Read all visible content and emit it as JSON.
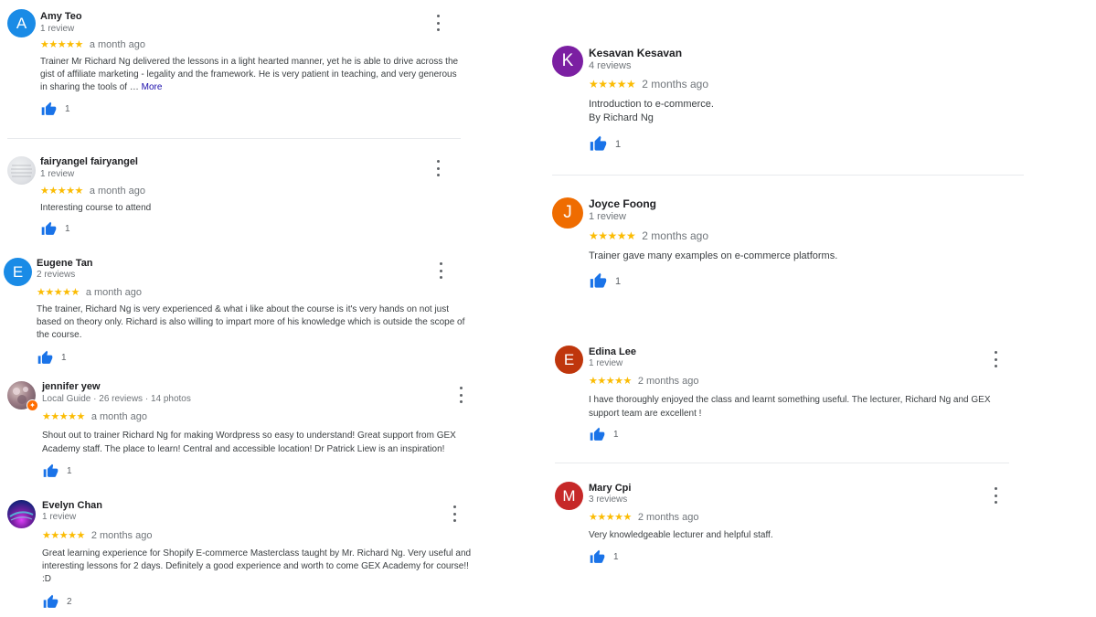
{
  "colors": {
    "star": "#fbbc04",
    "thumb": "#1a73e8",
    "more_link": "#1a0dab"
  },
  "reviews": [
    {
      "name": "Amy Teo",
      "meta": "1 review",
      "avatar_letter": "A",
      "avatar_color": "#1a8be6",
      "stars": "★★★★★",
      "rating": 5,
      "age": "a month ago",
      "text": "Trainer Mr Richard Ng delivered the lessons in a light hearted manner, yet he is able to drive across the gist of  affiliate marketing - legality and  the framework. He is very patient in teaching, and very generous in sharing the tools of … ",
      "more": "More",
      "likes": "1"
    },
    {
      "name": "fairyangel fairyangel",
      "meta": "1 review",
      "avatar_icon": "profile-photo-icon",
      "stars": "★★★★★",
      "rating": 5,
      "age": "a month ago",
      "text": "Interesting course to attend",
      "likes": "1"
    },
    {
      "name": "Eugene Tan",
      "meta": "2 reviews",
      "avatar_letter": "E",
      "avatar_color": "#1a8be6",
      "stars": "★★★★★",
      "rating": 5,
      "age": "a month ago",
      "text": "The trainer, Richard Ng is very experienced & what i like about the course is it's very hands on not just based on theory only. Richard is also willing to impart more of his knowledge which is outside the scope of the course.",
      "likes": "1"
    },
    {
      "name": "jennifer yew",
      "meta": "Local Guide · 26 reviews · 14 photos",
      "avatar_icon": "profile-photo-icon",
      "stars": "★★★★★",
      "rating": 5,
      "age": "a month ago",
      "text": "Shout out to trainer Richard Ng for making Wordpress so easy to understand! Great support from GEX Academy staff. The place to learn! Central and accessible location! Dr Patrick Liew is an inspiration!",
      "likes": "1"
    },
    {
      "name": "Evelyn Chan",
      "meta": "1 review",
      "avatar_icon": "profile-photo-icon",
      "stars": "★★★★★",
      "rating": 5,
      "age": "2 months ago",
      "text": "Great learning experience for Shopify E-commerce Masterclass taught by Mr. Richard Ng. Very useful and interesting lessons for 2 days. Definitely a good experience and worth to come GEX Academy for course!! :D",
      "likes": "2"
    },
    {
      "name": "Kesavan Kesavan",
      "meta": "4 reviews",
      "avatar_letter": "K",
      "avatar_color": "#7b1fa2",
      "stars": "★★★★★",
      "rating": 5,
      "age": "2 months ago",
      "text_line1": "Introduction to e-commerce.",
      "text_line2": "By Richard Ng",
      "likes": "1"
    },
    {
      "name": "Joyce Foong",
      "meta": "1 review",
      "avatar_letter": "J",
      "avatar_color": "#ef6c00",
      "stars": "★★★★★",
      "rating": 5,
      "age": "2 months ago",
      "text": "Trainer gave many examples on e-commerce platforms.",
      "likes": "1"
    },
    {
      "name": "Edina Lee",
      "meta": "1 review",
      "avatar_letter": "E",
      "avatar_color": "#bf360c",
      "stars": "★★★★★",
      "rating": 5,
      "age": "2 months ago",
      "text": "I have thoroughly enjoyed the class and learnt something useful. The lecturer, Richard Ng and GEX support team are excellent !",
      "likes": "1"
    },
    {
      "name": "Mary Cpi",
      "meta": "3 reviews",
      "avatar_letter": "M",
      "avatar_color": "#c62828",
      "stars": "★★★★★",
      "rating": 5,
      "age": "2 months ago",
      "text": "Very knowledgeable lecturer and helpful staff.",
      "likes": "1"
    }
  ]
}
